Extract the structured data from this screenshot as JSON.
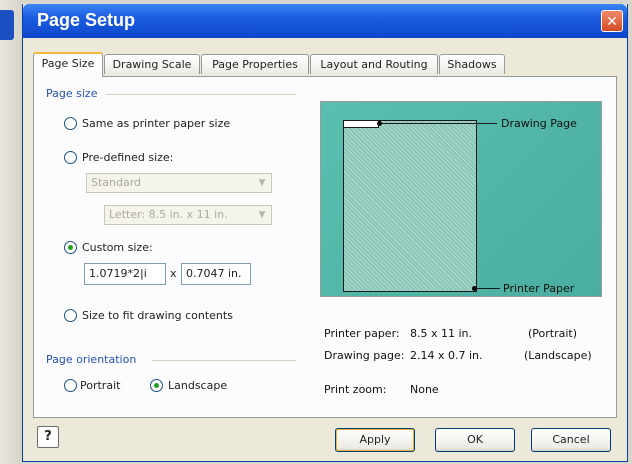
{
  "window": {
    "title": "Page Setup",
    "close_glyph": "✕"
  },
  "tabs": [
    {
      "label": "Page Size"
    },
    {
      "label": "Drawing Scale"
    },
    {
      "label": "Page Properties"
    },
    {
      "label": "Layout and Routing"
    },
    {
      "label": "Shadows"
    }
  ],
  "page_size": {
    "group_label": "Page size",
    "same_as_printer_label": "Same as printer paper size",
    "predefined_label": "Pre-defined size:",
    "predefined_type_value": "Standard",
    "predefined_size_value": "Letter: 8.5 in. x 11 in.",
    "custom_label": "Custom size:",
    "custom_width_value": "1.0719*2|i",
    "times_sign": "x",
    "custom_height_value": "0.7047 in.",
    "fit_label": "Size to fit drawing contents",
    "selected": "custom"
  },
  "orientation": {
    "group_label": "Page orientation",
    "portrait_label": "Portrait",
    "landscape_label": "Landscape",
    "selected": "landscape"
  },
  "preview": {
    "drawing_page_label": "Drawing Page",
    "printer_paper_label": "Printer Paper"
  },
  "info": {
    "printer_paper_label": "Printer paper:",
    "printer_paper_value": "8.5 x 11 in.",
    "printer_paper_orient": "(Portrait)",
    "drawing_page_label": "Drawing page:",
    "drawing_page_value": "2.14 x 0.7 in.",
    "drawing_page_orient": "(Landscape)",
    "print_zoom_label": "Print zoom:",
    "print_zoom_value": "None"
  },
  "buttons": {
    "help_glyph": "?",
    "apply": "Apply",
    "ok": "OK",
    "cancel": "Cancel"
  },
  "colors": {
    "title_bar": "#0d47c9",
    "preview_bg": "#52b7a8",
    "group_label": "#2650b0",
    "radio_selected": "#21a121"
  }
}
